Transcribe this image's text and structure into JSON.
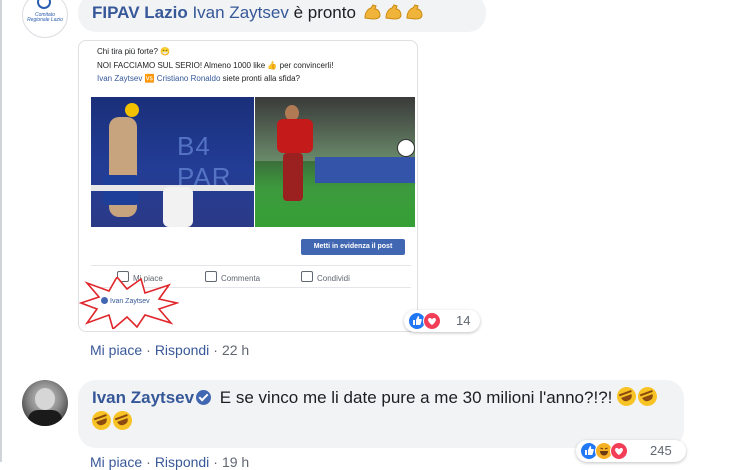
{
  "comment1": {
    "author": "FIPAV Lazio",
    "mention": "Ivan Zaytsev",
    "text": "è pronto",
    "avatar_text": "Comitato Regionale Lazio",
    "emoji_icons": [
      "flexed-biceps-icon",
      "flexed-biceps-icon",
      "flexed-biceps-icon"
    ],
    "reactions": {
      "icons": [
        "like-icon",
        "love-icon"
      ],
      "count": "14"
    },
    "actions": {
      "like": "Mi piace",
      "reply": "Rispondi",
      "time": "22 h"
    }
  },
  "embedded_post": {
    "line1": "Chi tira più forte? 😁",
    "line2": "NOI FACCIAMO SUL SERIO! Almeno 1000 like 👍 per convincerli!",
    "line3_mention1": "Ivan Zaytsev",
    "line3_vs": "🆚",
    "line3_mention2": "Cristiano Ronaldo",
    "line3_rest": "siete pronti alla sfida?",
    "photo_logo": "B4 PAR",
    "boost_button": "Metti in evidenza il post",
    "action_like": "Mi piace",
    "action_comment": "Commenta",
    "action_share": "Condividi",
    "tag": "Ivan Zaytsev"
  },
  "comment2": {
    "author": "Ivan Zaytsev",
    "text": "E se vinco me li date pure a me 30 milioni l'anno?!?!",
    "emoji_icons": [
      "rofl-icon",
      "rofl-icon",
      "rofl-icon",
      "rofl-icon"
    ],
    "reactions": {
      "icons": [
        "like-icon",
        "haha-icon",
        "love-icon"
      ],
      "count": "245"
    },
    "actions": {
      "like": "Mi piace",
      "reply": "Rispondi",
      "time": "19 h"
    }
  },
  "colors": {
    "link": "#385898",
    "author": "#365899",
    "bubble": "#f2f3f5",
    "like": "#2078f4",
    "love": "#f33e58",
    "haha": "#f7b125"
  }
}
